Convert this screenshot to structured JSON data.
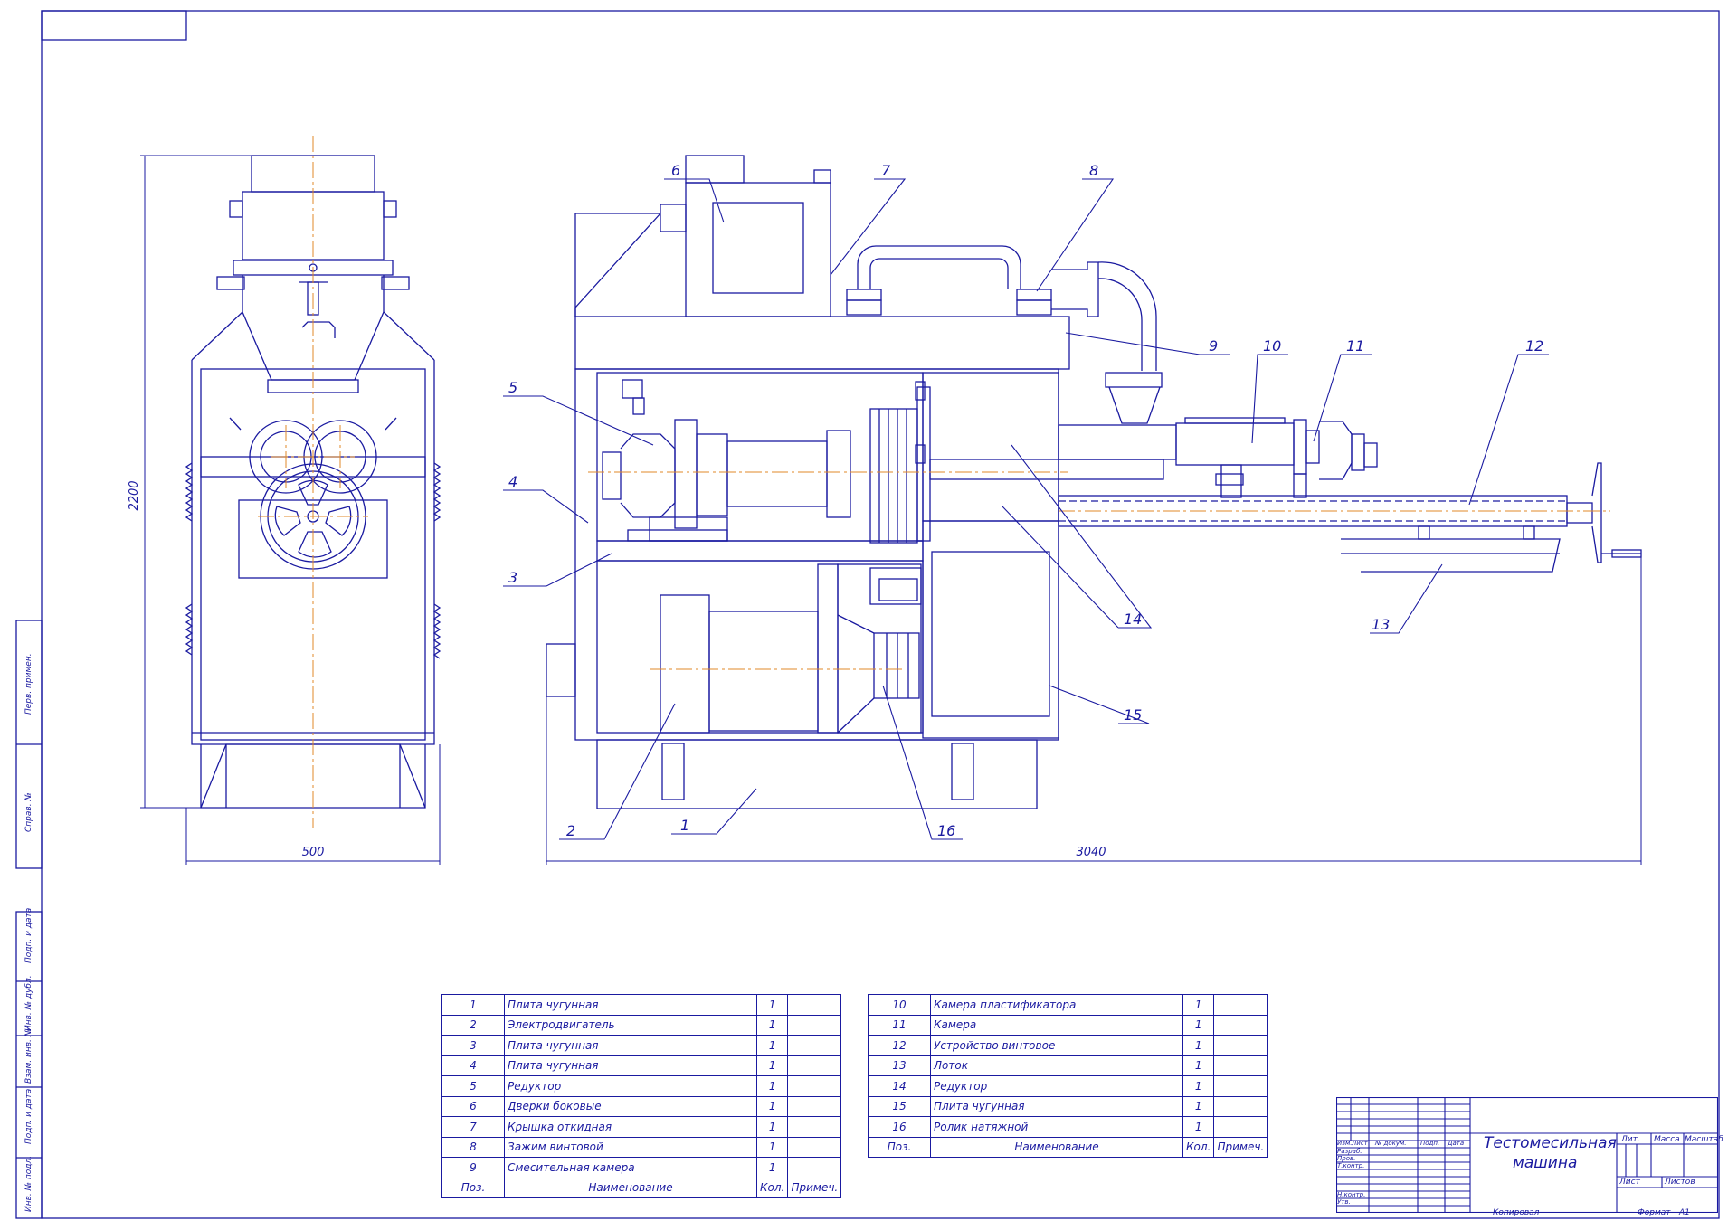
{
  "drawing": {
    "dimensions": {
      "height_left": "2200",
      "width_left": "500",
      "length_main": "3040"
    },
    "callouts": [
      "1",
      "2",
      "3",
      "4",
      "5",
      "6",
      "7",
      "8",
      "9",
      "10",
      "11",
      "12",
      "13",
      "14",
      "15",
      "16"
    ],
    "frame_labels": [
      "Перв. примен.",
      "Справ. №",
      "Подп. и дата",
      "Инв. № дубл.",
      "Взам. инв. №",
      "Подп. и дата",
      "Инв. № подл."
    ]
  },
  "spec_left": {
    "rows": [
      {
        "pos": "1",
        "name": "Плита чугунная",
        "qty": "1",
        "note": ""
      },
      {
        "pos": "2",
        "name": "Электродвигатель",
        "qty": "1",
        "note": ""
      },
      {
        "pos": "3",
        "name": "Плита чугунная",
        "qty": "1",
        "note": ""
      },
      {
        "pos": "4",
        "name": "Плита чугунная",
        "qty": "1",
        "note": ""
      },
      {
        "pos": "5",
        "name": "Редуктор",
        "qty": "1",
        "note": ""
      },
      {
        "pos": "6",
        "name": "Дверки боковые",
        "qty": "1",
        "note": ""
      },
      {
        "pos": "7",
        "name": "Крышка откидная",
        "qty": "1",
        "note": ""
      },
      {
        "pos": "8",
        "name": "Зажим винтовой",
        "qty": "1",
        "note": ""
      },
      {
        "pos": "9",
        "name": "Смесительная камера",
        "qty": "1",
        "note": ""
      }
    ],
    "header": {
      "pos": "Поз.",
      "name": "Наименование",
      "qty": "Кол.",
      "note": "Примеч."
    }
  },
  "spec_right": {
    "rows": [
      {
        "pos": "10",
        "name": "Камера пластификатора",
        "qty": "1",
        "note": ""
      },
      {
        "pos": "11",
        "name": "Камера",
        "qty": "1",
        "note": ""
      },
      {
        "pos": "12",
        "name": "Устройство винтовое",
        "qty": "1",
        "note": ""
      },
      {
        "pos": "13",
        "name": "Лоток",
        "qty": "1",
        "note": ""
      },
      {
        "pos": "14",
        "name": "Редуктор",
        "qty": "1",
        "note": ""
      },
      {
        "pos": "15",
        "name": "Плита чугунная",
        "qty": "1",
        "note": ""
      },
      {
        "pos": "16",
        "name": "Ролик натяжной",
        "qty": "1",
        "note": ""
      }
    ],
    "header": {
      "pos": "Поз.",
      "name": "Наименование",
      "qty": "Кол.",
      "note": "Примеч."
    }
  },
  "title_block": {
    "title_line1": "Тестомесильная",
    "title_line2": "машина",
    "lit": "Лит.",
    "mass": "Масса",
    "scale": "Масштаб",
    "sheet": "Лист",
    "sheets": "Листов",
    "col_izm": "Изм.",
    "col_list": "Лист",
    "col_doc": "№ докум.",
    "col_sign": "Подп.",
    "col_date": "Дата",
    "row_razrab": "Разраб.",
    "row_prov": "Пров.",
    "row_tkontr": "Т.контр.",
    "row_nkontr": "Н.контр.",
    "row_utv": "Утв.",
    "copied": "Копировал",
    "format": "Формат",
    "format_value": "А1"
  },
  "colors": {
    "line": "#1a1aa0",
    "axis": "#e08a2a"
  }
}
